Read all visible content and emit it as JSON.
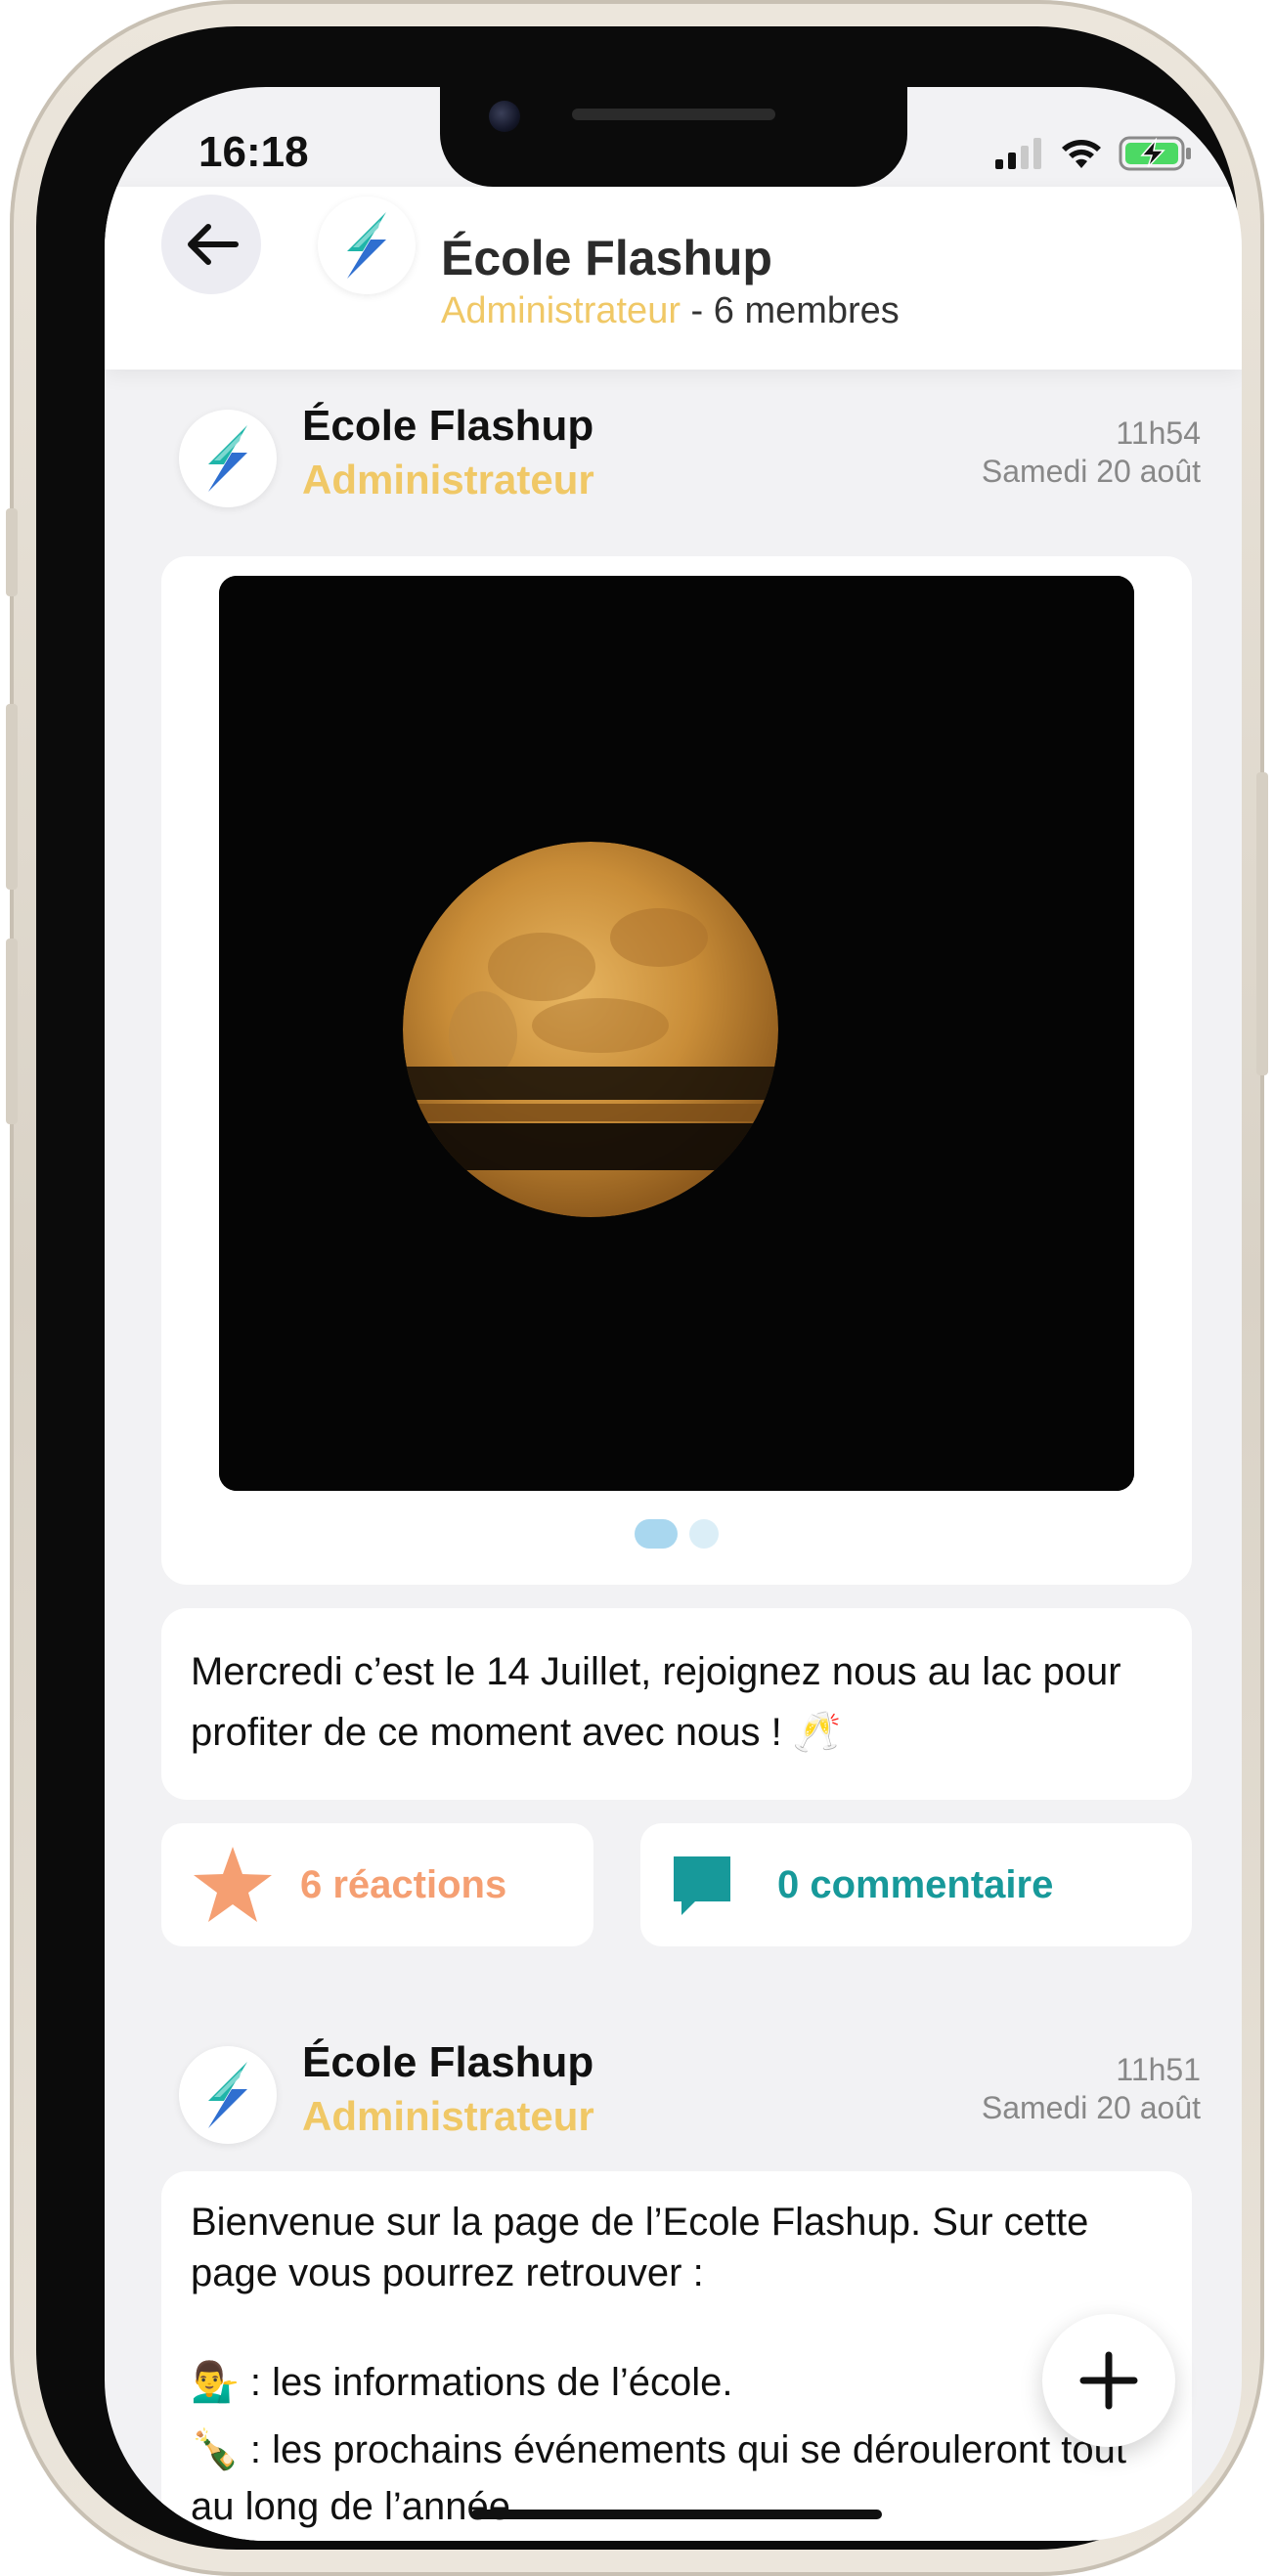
{
  "status_bar": {
    "time": "16:18"
  },
  "header": {
    "back_icon": "arrow-left-icon",
    "group_name": "École Flashup",
    "role": "Administrateur",
    "members": " - 6 membres"
  },
  "posts": [
    {
      "author": "École Flashup",
      "role": "Administrateur",
      "time": "11h54",
      "date": "Samedi 20 août",
      "image": "full-moon-photo",
      "carousel": {
        "count": 2,
        "active": 1
      },
      "text": "Mercredi c’est le 14 Juillet, rejoignez nous  au lac pour profiter de ce moment avec nous ! 🥂",
      "reactions": "6 réactions",
      "comments": "0 commentaire"
    },
    {
      "author": "École Flashup",
      "role": "Administrateur",
      "time": "11h51",
      "date": "Samedi 20 août",
      "text_intro": "Bienvenue sur la page de l’Ecole Flashup. Sur cette page vous pourrez retrouver :",
      "bullets": [
        {
          "emoji": "💁‍♂️",
          "text": " : les informations de l’école."
        },
        {
          "emoji": "🍾",
          "text": " : les prochains événements qui se dérouleront tout au long de l’année."
        }
      ]
    }
  ],
  "fab": {
    "icon": "plus-icon"
  },
  "colors": {
    "gold": "#f0c866",
    "reaction": "#f59f72",
    "comment": "#17999a",
    "logo_teal": "#1fb5a9",
    "logo_blue": "#2f6fd0"
  }
}
